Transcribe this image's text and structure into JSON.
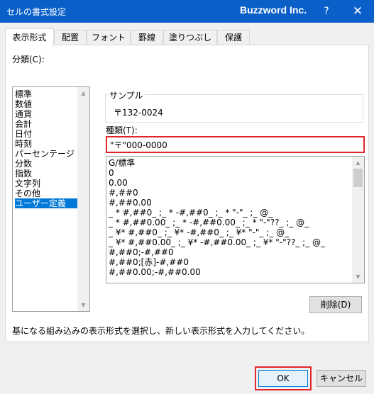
{
  "window": {
    "title": "セルの書式設定",
    "brand": "Buzzword Inc.",
    "help_label": "?",
    "close_label": "✕"
  },
  "tabs": [
    {
      "label": "表示形式",
      "active": true
    },
    {
      "label": "配置"
    },
    {
      "label": "フォント"
    },
    {
      "label": "罫線"
    },
    {
      "label": "塗りつぶし"
    },
    {
      "label": "保護"
    }
  ],
  "category": {
    "label": "分類(C):",
    "items": [
      "標準",
      "数値",
      "通貨",
      "会計",
      "日付",
      "時刻",
      "パーセンテージ",
      "分数",
      "指数",
      "文字列",
      "その他",
      "ユーザー定義"
    ],
    "selected_index": 11
  },
  "sample": {
    "label": "サンプル",
    "value": "〒132-0024"
  },
  "type": {
    "label": "種類(T):",
    "value": "\"〒\"000-0000"
  },
  "formats": [
    "G/標準",
    "0",
    "0.00",
    "#,##0",
    "#,##0.00",
    "_ * #,##0_ ;_ * -#,##0_ ;_ * \"-\"_ ;_ @_",
    "_ * #,##0.00_ ;_ * -#,##0.00_ ;_ * \"-\"??_ ;_ @_",
    "_ ¥* #,##0_ ;_ ¥* -#,##0_ ;_ ¥* \"-\"_ ;_ @_",
    "_ ¥* #,##0.00_ ;_ ¥* -#,##0.00_ ;_ ¥* \"-\"??_ ;_ @_",
    "#,##0;-#,##0",
    "#,##0;[赤]-#,##0",
    "#,##0.00;-#,##0.00"
  ],
  "delete_label": "削除(D)",
  "description": "基になる組み込みの表示形式を選択し、新しい表示形式を入力してください。",
  "ok_label": "OK",
  "cancel_label": "キャンセル",
  "colors": {
    "titlebar": "#0a5fc9",
    "selection": "#0078d7",
    "highlight_outline": "#e0262c"
  }
}
